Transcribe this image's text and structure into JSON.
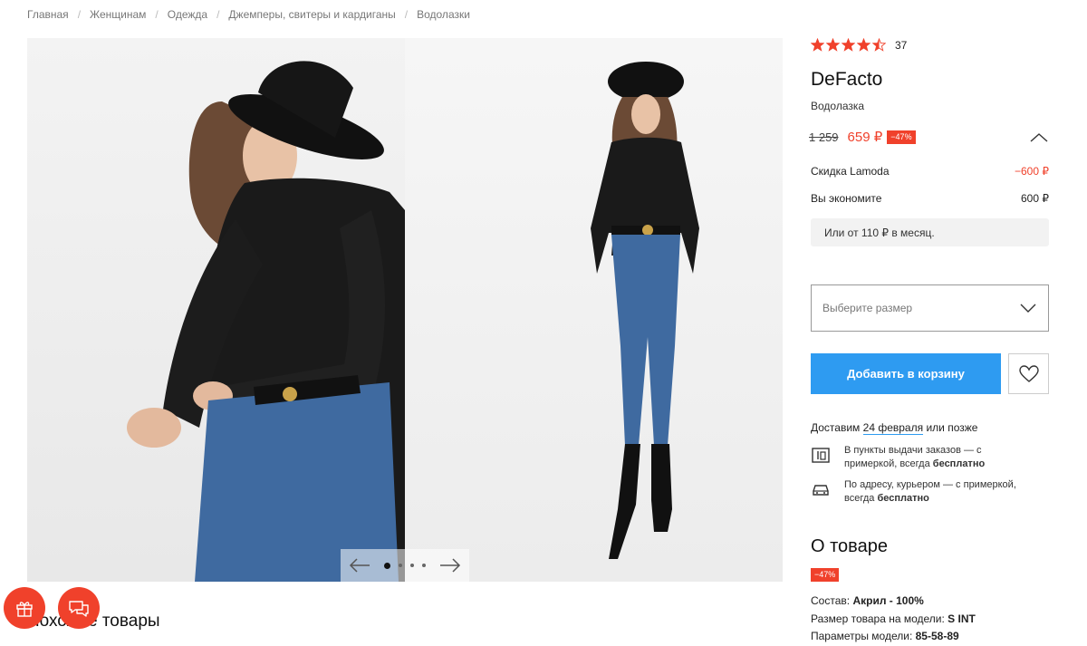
{
  "breadcrumb": [
    "Главная",
    "Женщинам",
    "Одежда",
    "Джемперы, свитеры и кардиганы",
    "Водолазки"
  ],
  "product": {
    "rating": 4.5,
    "rating_count": "37",
    "brand": "DeFacto",
    "type": "Водолазка",
    "old_price": "1 259",
    "price": "659 ₽",
    "discount_badge": "−47%",
    "lamoda_discount_label": "Скидка Lamoda",
    "lamoda_discount_value": "−600 ₽",
    "savings_label": "Вы экономите",
    "savings_value": "600 ₽",
    "installment": "Или от 110 ₽ в месяц."
  },
  "size_select": {
    "placeholder": "Выберите размер"
  },
  "buttons": {
    "add_to_cart": "Добавить в корзину"
  },
  "delivery": {
    "prefix": "Доставим",
    "date": "24 февраля",
    "suffix": "или позже",
    "options": [
      {
        "icon": "pickup-point-icon",
        "line1": "В пункты выдачи заказов — с",
        "line2_pre": "примеркой, всегда",
        "line2_bold": "бесплатно"
      },
      {
        "icon": "courier-car-icon",
        "line1": "По адресу, курьером — с примеркой,",
        "line2_pre": "всегда",
        "line2_bold": "бесплатно"
      }
    ]
  },
  "about": {
    "title": "О товаре",
    "badge": "−47%",
    "specs": [
      {
        "label": "Состав:",
        "value": "Акрил - 100%"
      },
      {
        "label": "Размер товара на модели:",
        "value": "S INT"
      },
      {
        "label": "Параметры модели:",
        "value": "85-58-89"
      }
    ]
  },
  "gallery": {
    "total": 5,
    "active": 1
  },
  "similar_title": "Похожие товары",
  "colors": {
    "accent": "#f0412b",
    "button": "#2e9bf1"
  }
}
